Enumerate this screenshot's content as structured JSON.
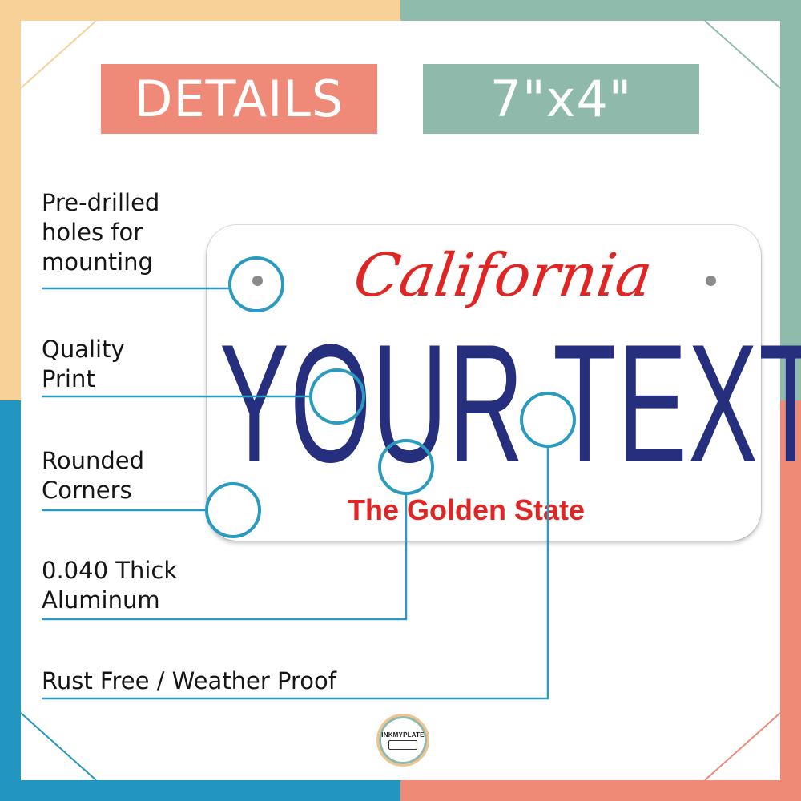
{
  "header": {
    "details_label": "DETAILS",
    "size_label": "7\"x4\""
  },
  "features": [
    {
      "label_lines": [
        "Pre-drilled",
        "holes for",
        "mounting"
      ]
    },
    {
      "label_lines": [
        "Quality",
        "Print"
      ]
    },
    {
      "label_lines": [
        "Rounded",
        "Corners"
      ]
    },
    {
      "label_lines": [
        "0.040 Thick",
        "Aluminum"
      ]
    },
    {
      "label_lines": [
        "Rust Free / Weather Proof"
      ]
    }
  ],
  "plate": {
    "state": "California",
    "text": "YOUR TEXT",
    "slogan": "The Golden State"
  },
  "logo": {
    "text": "INKMYPLATE"
  },
  "colors": {
    "salmon": "#f08a78",
    "sage": "#8fbaab",
    "sand": "#f7d197",
    "teal": "#2295c0",
    "plate_blue": "#262f7e",
    "plate_red": "#e02624",
    "callout": "#2a9bbf"
  }
}
